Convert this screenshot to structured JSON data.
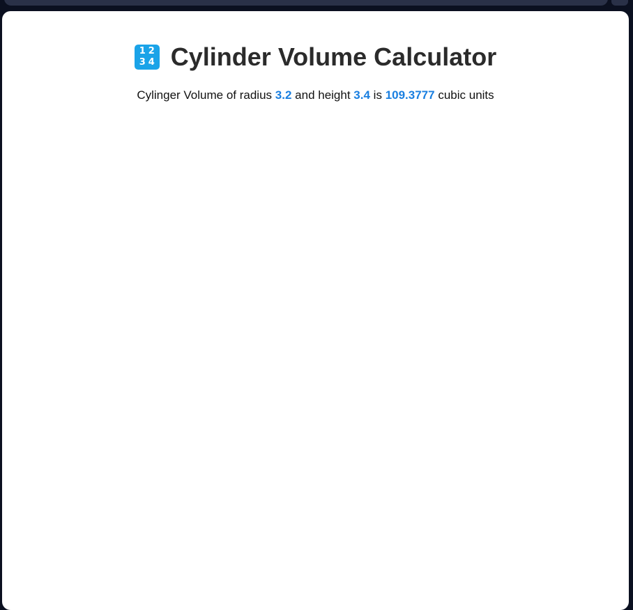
{
  "page": {
    "title": "Cylinder Volume Calculator",
    "icon": "input-numbers-icon",
    "icon_digits": [
      "1",
      "2",
      "3",
      "4"
    ]
  },
  "result": {
    "prefix": "Cylinger Volume of radius",
    "radius": "3.2",
    "middle": "and height",
    "height": "3.4",
    "is_word": "is",
    "volume": "109.3777",
    "suffix": "cubic units"
  },
  "colors": {
    "highlight": "#1a7fe0",
    "icon_bg": "#1aa3e8",
    "background": "#0b1020",
    "card": "#ffffff"
  }
}
